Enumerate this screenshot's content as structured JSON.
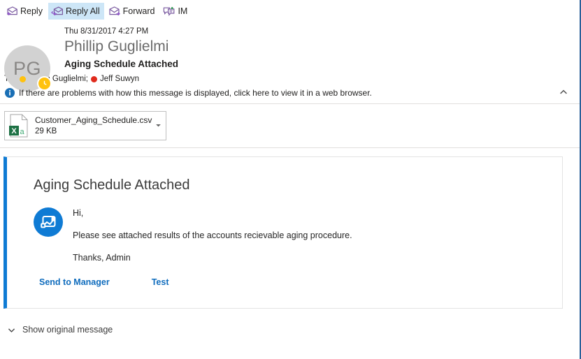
{
  "toolbar": {
    "buttons": [
      {
        "label": "Reply",
        "icon": "reply-icon",
        "active": false
      },
      {
        "label": "Reply All",
        "icon": "reply-all-icon",
        "active": true
      },
      {
        "label": "Forward",
        "icon": "forward-icon",
        "active": false
      },
      {
        "label": "IM",
        "icon": "instant-message-icon",
        "active": false
      }
    ]
  },
  "message": {
    "avatar_initials": "PG",
    "presence_badge": "clock-away-icon",
    "date": "Thu 8/31/2017 4:27 PM",
    "sender": "Phillip Guglielmi",
    "subject": "Aging Schedule Attached",
    "to_label": "To",
    "recipients": [
      {
        "name": "Phillip Guglielmi;",
        "presence": "away",
        "presence_color": "#ffc20e"
      },
      {
        "name": "Jeff Suwyn",
        "presence": "busy",
        "presence_color": "#e02b1d"
      }
    ]
  },
  "infobar": {
    "icon": "info-icon",
    "text": "If there are problems with how this message is displayed, click here to view it in a web browser.",
    "collapse_icon": "chevron-up-icon"
  },
  "attachment": {
    "icon": "excel-csv-file-icon",
    "filename": "Customer_Aging_Schedule.csv",
    "size": "29 KB",
    "caret_icon": "chevron-down-icon"
  },
  "body": {
    "accent_color": "#0f7bd4",
    "title": "Aging Schedule Attached",
    "logo_icon": "microsoft-flow-icon",
    "greeting": "Hi,",
    "paragraph": "Please see attached results of the accounts recievable aging procedure.",
    "signoff": "Thanks, Admin",
    "link_color": "#0f6cbd",
    "actions": [
      {
        "label": "Send to Manager"
      },
      {
        "label": "Test"
      }
    ]
  },
  "footer": {
    "chevron_icon": "chevron-down-icon",
    "label": "Show original message"
  }
}
